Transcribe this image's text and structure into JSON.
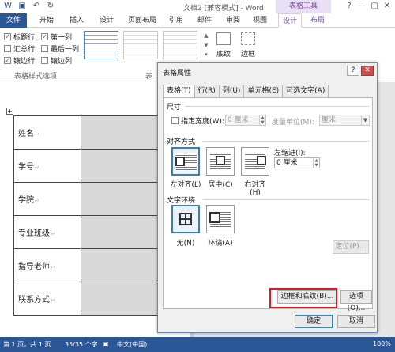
{
  "titlebar": {
    "doc_title": "文档2 [兼容模式] - Word",
    "context_group": "表格工具",
    "qat_icons": [
      "word-icon",
      "save-icon",
      "undo-icon",
      "redo-icon"
    ],
    "help": "?",
    "minimize": "—",
    "restore": "▢",
    "close": "✕"
  },
  "ribbon_tabs": {
    "file": "文件",
    "home": "开始",
    "insert": "插入",
    "design_main": "设计",
    "layout_main": "页面布局",
    "references": "引用",
    "mailings": "邮件",
    "review": "审阅",
    "view": "视图",
    "design": "设计",
    "layout": "布局"
  },
  "style_options": {
    "header_row": "标题行",
    "first_col": "第一列",
    "total_row": "汇总行",
    "last_col": "最后一列",
    "banded_rows": "镶边行",
    "banded_cols": "镶边列",
    "group_label": "表格样式选项",
    "styles_group_label": "表"
  },
  "ribbon_buttons": {
    "shading": "底纹",
    "borders": "边框"
  },
  "document": {
    "rows": [
      "姓名",
      "学号",
      "学院",
      "专业班级",
      "指导老师",
      "联系方式"
    ],
    "para_mark": "↵",
    "anchor": "+"
  },
  "statusbar": {
    "page": "第 1 页，共 1 页",
    "words": "35/35 个字",
    "lang": "中文(中国)",
    "zoom": "100%"
  },
  "dialog": {
    "title": "表格属性",
    "help": "?",
    "close": "✕",
    "tabs": [
      "表格(T)",
      "行(R)",
      "列(U)",
      "单元格(E)",
      "可选文字(A)"
    ],
    "size_section": "尺寸",
    "preferred_width_label": "指定宽度(W):",
    "preferred_width_value": "0 厘米",
    "measure_in_label": "度量单位(M):",
    "measure_in_value": "厘米",
    "alignment_section": "对齐方式",
    "align_left": "左对齐(L)",
    "align_center": "居中(C)",
    "align_right": "右对齐(H)",
    "indent_label": "左缩进(I):",
    "indent_value": "0 厘米",
    "wrap_section": "文字环绕",
    "wrap_none": "无(N)",
    "wrap_around": "环绕(A)",
    "positioning_button": "定位(P)...",
    "borders_button": "边框和底纹(B)...",
    "options_button": "选项(O)...",
    "ok_button": "确定",
    "cancel_button": "取消"
  },
  "colors": {
    "accent": "#2b5797",
    "context": "#7a4fa8",
    "highlight": "#e0191e"
  }
}
